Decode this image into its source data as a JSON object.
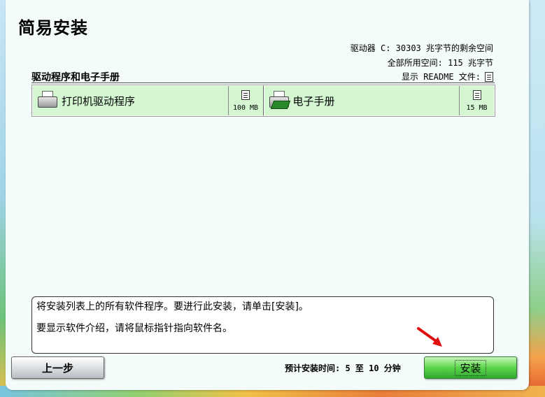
{
  "window": {
    "title": "简易安装"
  },
  "disk": {
    "free_space": "驱动器 C: 30303 兆字节的剩余空间",
    "used_space": "全部所用空间: 115 兆字节"
  },
  "section": {
    "title": "驱动程序和电子手册",
    "readme_label": "显示 README 文件:"
  },
  "items": [
    {
      "label": "打印机驱动程序",
      "size": "100 MB",
      "icon": "printer-icon"
    },
    {
      "label": "电子手册",
      "size": "15 MB",
      "icon": "manual-icon"
    }
  ],
  "description": {
    "line1": "将安装列表上的所有软件程序。要进行此安装，请单击[安装]。",
    "line2": "要显示软件介绍，请将鼠标指针指向软件名。"
  },
  "footer": {
    "back_label": "上一步",
    "time_label": "预计安装时间: 5 至 10 分钟",
    "install_label": "安装"
  },
  "colors": {
    "accent": "#5bd64b",
    "item_bg": "#d4f7d2",
    "annotation_arrow": "#e01010"
  }
}
